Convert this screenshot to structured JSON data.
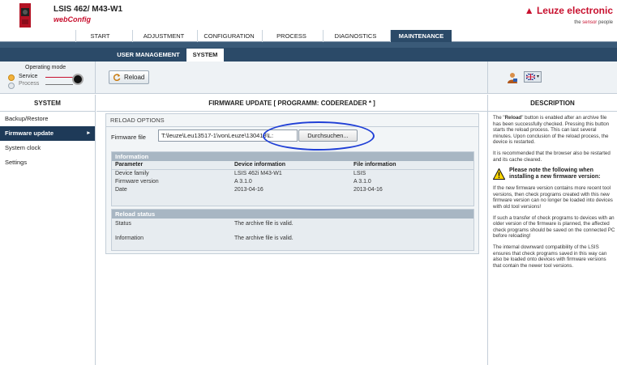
{
  "header": {
    "product_title": "LSIS 462/ M43-W1",
    "product_subtitle": "webConfig",
    "brand": "Leuze electronic",
    "slogan_prefix": "the ",
    "slogan_highlight": "sensor",
    "slogan_suffix": " people"
  },
  "main_nav": {
    "tabs": [
      "START",
      "ADJUSTMENT",
      "CONFIGURATION",
      "PROCESS",
      "DIAGNOSTICS",
      "MAINTENANCE"
    ],
    "active": "MAINTENANCE"
  },
  "sub_nav": {
    "tabs": [
      "USER MANAGEMENT",
      "SYSTEM"
    ],
    "active": "SYSTEM"
  },
  "toolbar": {
    "operating_mode_label": "Operating mode",
    "service_label": "Service",
    "process_label": "Process",
    "reload_label": "Reload"
  },
  "sidebar": {
    "title": "SYSTEM",
    "items": [
      "Backup/Restore",
      "Firmware update",
      "System clock",
      "Settings"
    ],
    "active": "Firmware update",
    "active_arrow": "▸"
  },
  "main": {
    "title": "FIRMWARE UPDATE   [ PROGRAMM: CODEREADER * ]",
    "reload_options_title": "RELOAD OPTIONS",
    "firmware_file_label": "Firmware file",
    "firmware_file_value": "T:\\leuze\\Leu13517-1\\vonLeuze\\130418\\L:",
    "browse_label": "Durchsuchen...",
    "information": {
      "title": "Information",
      "headers": [
        "Parameter",
        "Device information",
        "File information"
      ],
      "rows": [
        [
          "Device family",
          "LSIS 462i M43-W1",
          "LSIS"
        ],
        [
          "Firmware version",
          "A 3.1.0",
          "A 3.1.0"
        ],
        [
          "Date",
          "2013-04-16",
          "2013-04-16"
        ]
      ]
    },
    "reload_status": {
      "title": "Reload status",
      "rows": [
        [
          "Status",
          "The archive file is valid."
        ],
        [
          "Information",
          "The archive file is valid."
        ]
      ]
    }
  },
  "description": {
    "title": "DESCRIPTION",
    "p1_before": "The \"",
    "p1_bold": "Reload",
    "p1_after": "\" button is enabled after an archive file has been successfully checked. Pressing this button starts the reload process. This can last several minutes. Upon conclusion of the reload process, the device is restarted.",
    "p2": "It is recommended that the browser also be restarted and its cache cleared.",
    "warning": "Please note the following when installing a new firmware version:",
    "p3": "If the new firmware version contains more recent tool versions, then check programs created with this new firmware version can no longer be loaded into devices with old tool versions!",
    "p4": "If such a transfer of check programs to devices with an older version of the firmware is planned, the affected check programs should be saved on the connected PC before reloading!",
    "p5": "The internal downward compatibility of the LSIS ensures that check programs saved in this way can also be loaded onto devices with firmware versions that contain the newer tool versions."
  },
  "colors": {
    "brand_red": "#c8102e",
    "nav_dark": "#2b4a68",
    "highlight_ellipse": "#1f3fd6"
  }
}
